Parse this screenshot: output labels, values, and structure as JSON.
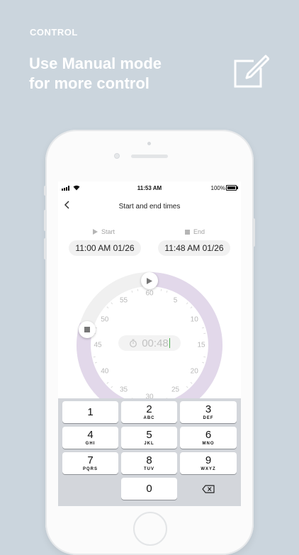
{
  "promo": {
    "section_label": "CONTROL",
    "headline_line1": "Use Manual mode",
    "headline_line2": "for more control",
    "icon": "edit-square-icon"
  },
  "status_bar": {
    "time": "11:53 AM",
    "battery": "100%"
  },
  "nav": {
    "title": "Start and end times",
    "back": "‹"
  },
  "start": {
    "label": "Start",
    "time": "11:00 AM",
    "date": "01/26"
  },
  "end": {
    "label": "End",
    "time": "11:48 AM",
    "date": "01/26"
  },
  "dial": {
    "numbers": [
      "60",
      "5",
      "10",
      "15",
      "20",
      "25",
      "30",
      "35",
      "40",
      "45",
      "50",
      "55"
    ],
    "duration": "00:48",
    "start_handle_icon": "play-icon",
    "end_handle_icon": "stop-icon",
    "ring_color": "#e2d8ea",
    "track_color": "#f0f0f0",
    "cursor_color": "#4caf50"
  },
  "keypad": {
    "keys": [
      {
        "num": "1",
        "letters": ""
      },
      {
        "num": "2",
        "letters": "ABC"
      },
      {
        "num": "3",
        "letters": "DEF"
      },
      {
        "num": "4",
        "letters": "GHI"
      },
      {
        "num": "5",
        "letters": "JKL"
      },
      {
        "num": "6",
        "letters": "MNO"
      },
      {
        "num": "7",
        "letters": "PQRS"
      },
      {
        "num": "8",
        "letters": "TUV"
      },
      {
        "num": "9",
        "letters": "WXYZ"
      },
      {
        "num": "0",
        "letters": ""
      }
    ],
    "delete_icon": "backspace-icon"
  }
}
